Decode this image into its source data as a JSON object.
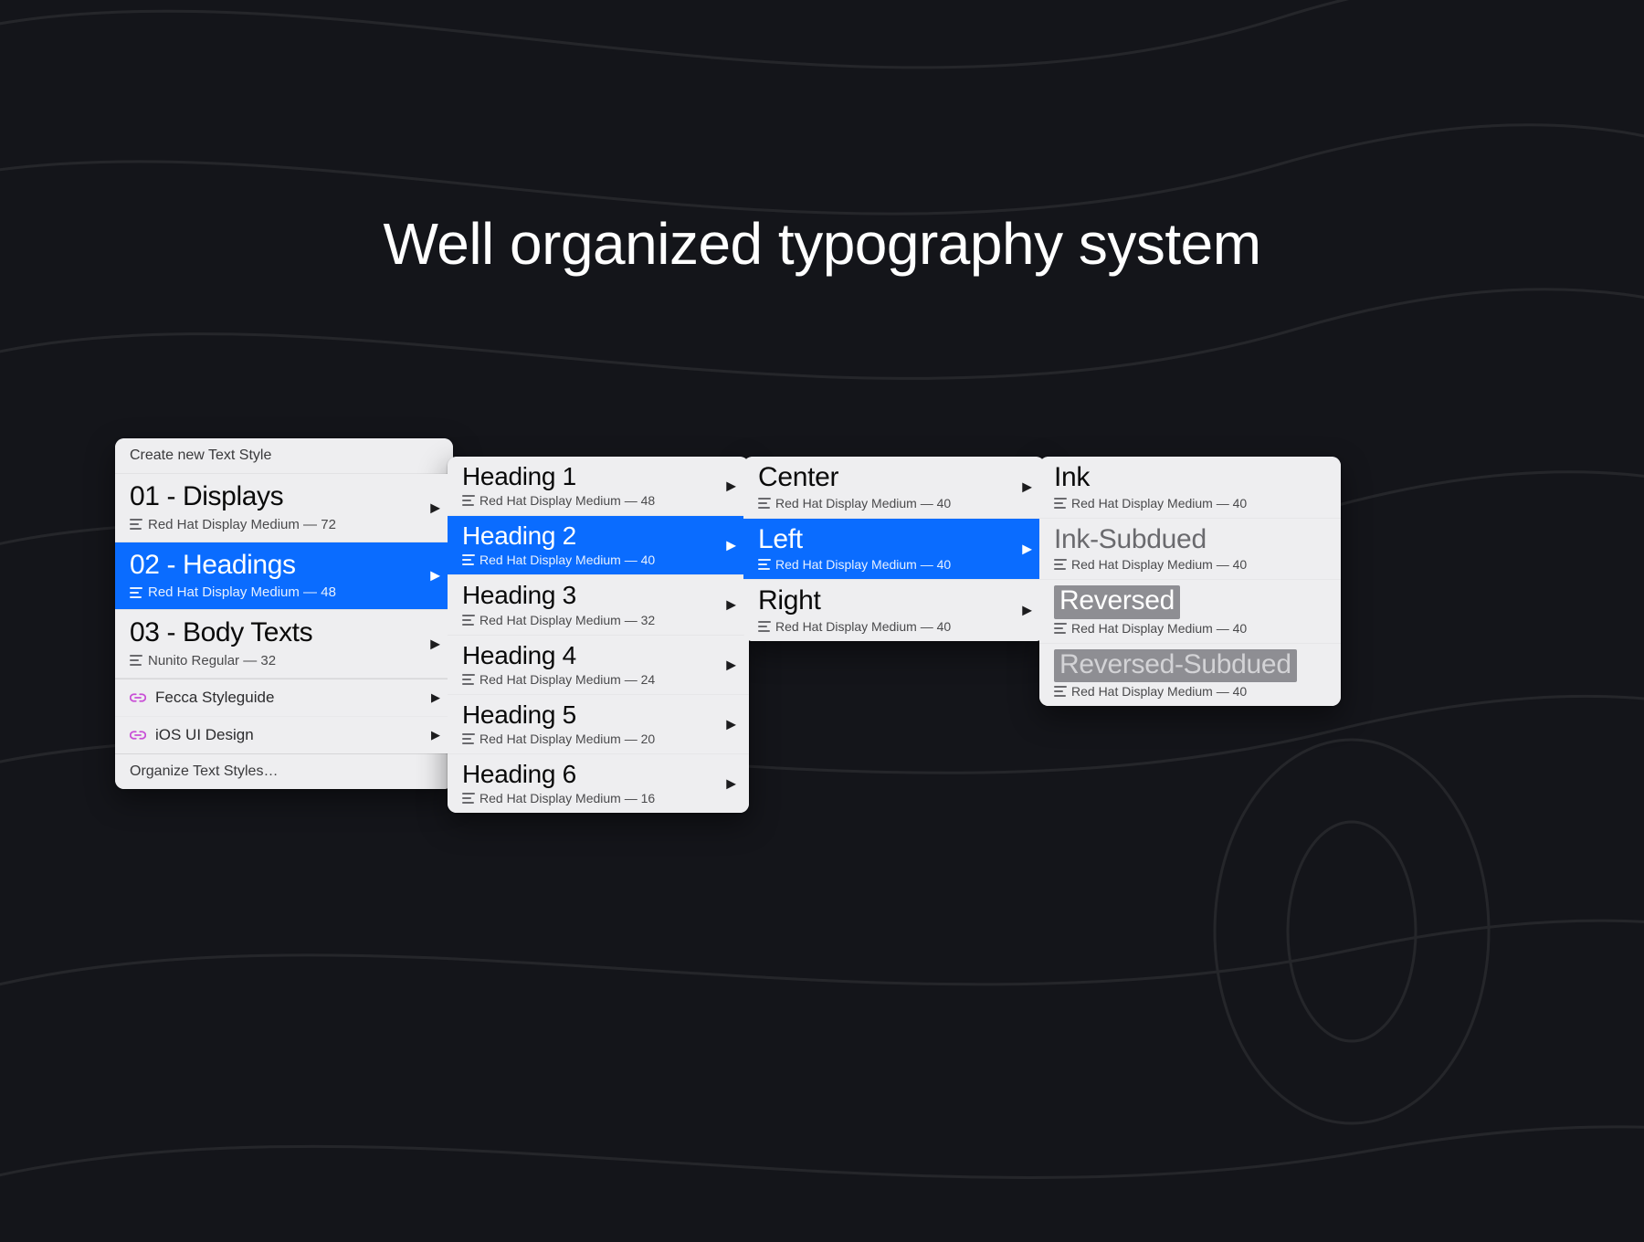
{
  "title": "Well organized typography system",
  "colors": {
    "accent": "#0a6cff",
    "bg": "#14151a"
  },
  "panel0": {
    "header": "Create new Text Style",
    "items": [
      {
        "label": "01 - Displays",
        "meta": "Red Hat Display Medium — 72",
        "selected": false
      },
      {
        "label": "02 - Headings",
        "meta": "Red Hat Display Medium — 48",
        "selected": true
      },
      {
        "label": "03 - Body Texts",
        "meta": "Nunito Regular — 32",
        "selected": false
      }
    ],
    "links": [
      {
        "label": "Fecca Styleguide"
      },
      {
        "label": "iOS UI Design"
      }
    ],
    "footer": "Organize Text Styles…"
  },
  "panel1": {
    "items": [
      {
        "label": "Heading 1",
        "meta": "Red Hat Display Medium — 48",
        "selected": false
      },
      {
        "label": "Heading 2",
        "meta": "Red Hat Display Medium — 40",
        "selected": true
      },
      {
        "label": "Heading 3",
        "meta": "Red Hat Display Medium — 32",
        "selected": false
      },
      {
        "label": "Heading 4",
        "meta": "Red Hat Display Medium — 24",
        "selected": false
      },
      {
        "label": "Heading 5",
        "meta": "Red Hat Display Medium — 20",
        "selected": false
      },
      {
        "label": "Heading 6",
        "meta": "Red Hat Display Medium — 16",
        "selected": false
      }
    ]
  },
  "panel2": {
    "items": [
      {
        "label": "Center",
        "meta": "Red Hat Display Medium — 40",
        "selected": false
      },
      {
        "label": "Left",
        "meta": "Red Hat Display Medium — 40",
        "selected": true
      },
      {
        "label": "Right",
        "meta": "Red Hat Display Medium — 40",
        "selected": false
      }
    ]
  },
  "panel3": {
    "items": [
      {
        "label": "Ink",
        "meta": "Red Hat Display Medium — 40",
        "variant": "ink"
      },
      {
        "label": "Ink-Subdued",
        "meta": "Red Hat Display Medium — 40",
        "variant": "ink-subdued"
      },
      {
        "label": "Reversed",
        "meta": "Red Hat Display Medium — 40",
        "variant": "reversed"
      },
      {
        "label": "Reversed-Subdued",
        "meta": "Red Hat Display Medium — 40",
        "variant": "reversed-subdued"
      }
    ]
  }
}
